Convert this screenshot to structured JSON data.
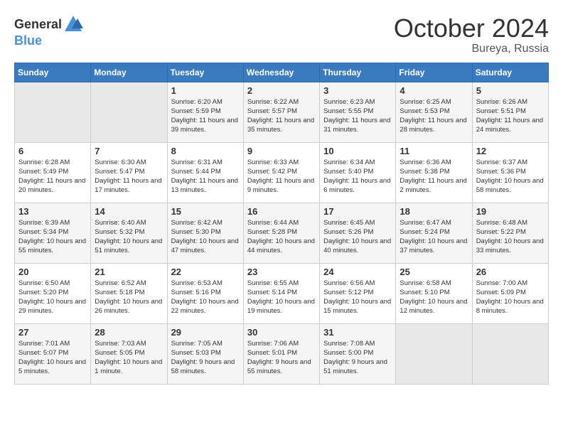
{
  "header": {
    "logo_general": "General",
    "logo_blue": "Blue",
    "month": "October 2024",
    "location": "Bureya, Russia"
  },
  "weekdays": [
    "Sunday",
    "Monday",
    "Tuesday",
    "Wednesday",
    "Thursday",
    "Friday",
    "Saturday"
  ],
  "weeks": [
    [
      {
        "day": "",
        "info": ""
      },
      {
        "day": "",
        "info": ""
      },
      {
        "day": "1",
        "info": "Sunrise: 6:20 AM\nSunset: 5:59 PM\nDaylight: 11 hours and 39 minutes."
      },
      {
        "day": "2",
        "info": "Sunrise: 6:22 AM\nSunset: 5:57 PM\nDaylight: 11 hours and 35 minutes."
      },
      {
        "day": "3",
        "info": "Sunrise: 6:23 AM\nSunset: 5:55 PM\nDaylight: 11 hours and 31 minutes."
      },
      {
        "day": "4",
        "info": "Sunrise: 6:25 AM\nSunset: 5:53 PM\nDaylight: 11 hours and 28 minutes."
      },
      {
        "day": "5",
        "info": "Sunrise: 6:26 AM\nSunset: 5:51 PM\nDaylight: 11 hours and 24 minutes."
      }
    ],
    [
      {
        "day": "6",
        "info": "Sunrise: 6:28 AM\nSunset: 5:49 PM\nDaylight: 11 hours and 20 minutes."
      },
      {
        "day": "7",
        "info": "Sunrise: 6:30 AM\nSunset: 5:47 PM\nDaylight: 11 hours and 17 minutes."
      },
      {
        "day": "8",
        "info": "Sunrise: 6:31 AM\nSunset: 5:44 PM\nDaylight: 11 hours and 13 minutes."
      },
      {
        "day": "9",
        "info": "Sunrise: 6:33 AM\nSunset: 5:42 PM\nDaylight: 11 hours and 9 minutes."
      },
      {
        "day": "10",
        "info": "Sunrise: 6:34 AM\nSunset: 5:40 PM\nDaylight: 11 hours and 6 minutes."
      },
      {
        "day": "11",
        "info": "Sunrise: 6:36 AM\nSunset: 5:38 PM\nDaylight: 11 hours and 2 minutes."
      },
      {
        "day": "12",
        "info": "Sunrise: 6:37 AM\nSunset: 5:36 PM\nDaylight: 10 hours and 58 minutes."
      }
    ],
    [
      {
        "day": "13",
        "info": "Sunrise: 6:39 AM\nSunset: 5:34 PM\nDaylight: 10 hours and 55 minutes."
      },
      {
        "day": "14",
        "info": "Sunrise: 6:40 AM\nSunset: 5:32 PM\nDaylight: 10 hours and 51 minutes."
      },
      {
        "day": "15",
        "info": "Sunrise: 6:42 AM\nSunset: 5:30 PM\nDaylight: 10 hours and 47 minutes."
      },
      {
        "day": "16",
        "info": "Sunrise: 6:44 AM\nSunset: 5:28 PM\nDaylight: 10 hours and 44 minutes."
      },
      {
        "day": "17",
        "info": "Sunrise: 6:45 AM\nSunset: 5:26 PM\nDaylight: 10 hours and 40 minutes."
      },
      {
        "day": "18",
        "info": "Sunrise: 6:47 AM\nSunset: 5:24 PM\nDaylight: 10 hours and 37 minutes."
      },
      {
        "day": "19",
        "info": "Sunrise: 6:48 AM\nSunset: 5:22 PM\nDaylight: 10 hours and 33 minutes."
      }
    ],
    [
      {
        "day": "20",
        "info": "Sunrise: 6:50 AM\nSunset: 5:20 PM\nDaylight: 10 hours and 29 minutes."
      },
      {
        "day": "21",
        "info": "Sunrise: 6:52 AM\nSunset: 5:18 PM\nDaylight: 10 hours and 26 minutes."
      },
      {
        "day": "22",
        "info": "Sunrise: 6:53 AM\nSunset: 5:16 PM\nDaylight: 10 hours and 22 minutes."
      },
      {
        "day": "23",
        "info": "Sunrise: 6:55 AM\nSunset: 5:14 PM\nDaylight: 10 hours and 19 minutes."
      },
      {
        "day": "24",
        "info": "Sunrise: 6:56 AM\nSunset: 5:12 PM\nDaylight: 10 hours and 15 minutes."
      },
      {
        "day": "25",
        "info": "Sunrise: 6:58 AM\nSunset: 5:10 PM\nDaylight: 10 hours and 12 minutes."
      },
      {
        "day": "26",
        "info": "Sunrise: 7:00 AM\nSunset: 5:09 PM\nDaylight: 10 hours and 8 minutes."
      }
    ],
    [
      {
        "day": "27",
        "info": "Sunrise: 7:01 AM\nSunset: 5:07 PM\nDaylight: 10 hours and 5 minutes."
      },
      {
        "day": "28",
        "info": "Sunrise: 7:03 AM\nSunset: 5:05 PM\nDaylight: 10 hours and 1 minute."
      },
      {
        "day": "29",
        "info": "Sunrise: 7:05 AM\nSunset: 5:03 PM\nDaylight: 9 hours and 58 minutes."
      },
      {
        "day": "30",
        "info": "Sunrise: 7:06 AM\nSunset: 5:01 PM\nDaylight: 9 hours and 55 minutes."
      },
      {
        "day": "31",
        "info": "Sunrise: 7:08 AM\nSunset: 5:00 PM\nDaylight: 9 hours and 51 minutes."
      },
      {
        "day": "",
        "info": ""
      },
      {
        "day": "",
        "info": ""
      }
    ]
  ]
}
